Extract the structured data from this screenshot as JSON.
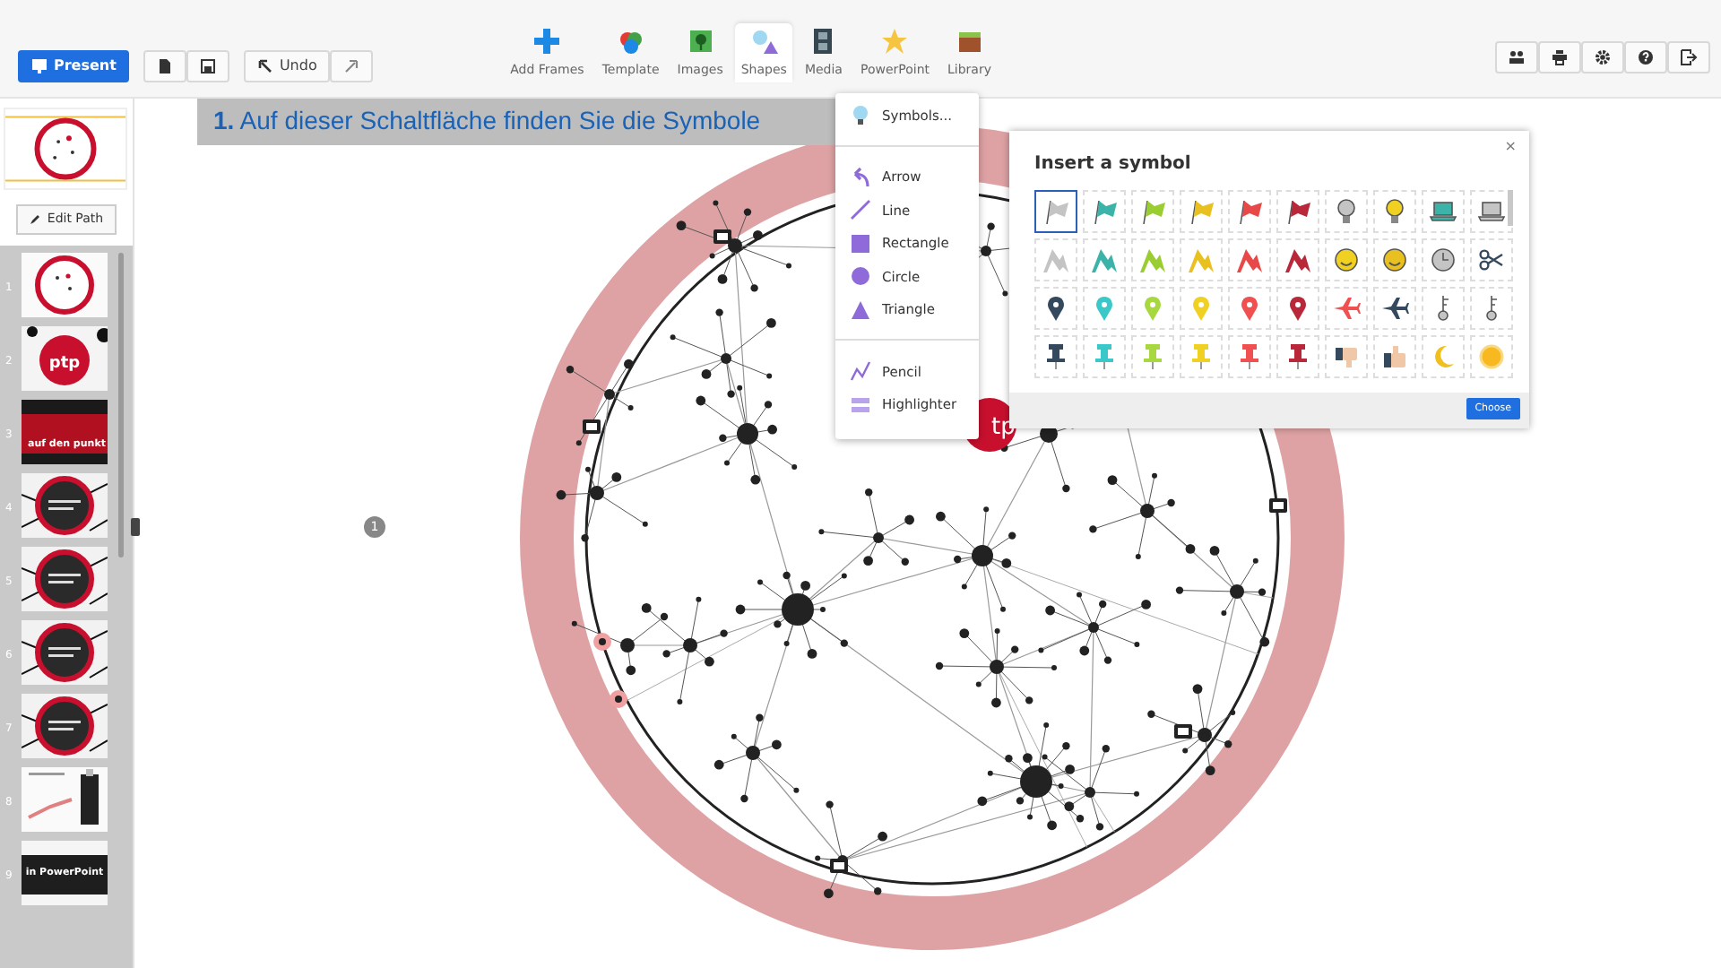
{
  "left_buttons": [
    {
      "kind": "present",
      "label": "Present"
    },
    {
      "kind": "new"
    },
    {
      "kind": "save"
    },
    {
      "kind": "undo",
      "label": "Undo"
    },
    {
      "kind": "redo"
    }
  ],
  "insert_tools": [
    {
      "kind": "frames",
      "label": "Add Frames",
      "selected": false
    },
    {
      "kind": "template",
      "label": "Template",
      "selected": false
    },
    {
      "kind": "images",
      "label": "Images",
      "selected": false
    },
    {
      "kind": "shapes",
      "label": "Shapes",
      "selected": true
    },
    {
      "kind": "media",
      "label": "Media",
      "selected": false
    },
    {
      "kind": "powerpoint",
      "label": "PowerPoint",
      "selected": false
    },
    {
      "kind": "library",
      "label": "Library",
      "selected": false
    }
  ],
  "right_buttons": [
    {
      "kind": "people"
    },
    {
      "kind": "print"
    },
    {
      "kind": "settings"
    },
    {
      "kind": "help"
    },
    {
      "kind": "exit"
    }
  ],
  "sidebar": {
    "edit_path": "Edit Path",
    "slides": [
      {
        "number": "1",
        "kind": "circle"
      },
      {
        "number": "2",
        "kind": "ptp",
        "text": "ptp"
      },
      {
        "number": "3",
        "kind": "banner",
        "text": "auf den punkt"
      },
      {
        "number": "4",
        "kind": "dark-circle"
      },
      {
        "number": "5",
        "kind": "dark-circle"
      },
      {
        "number": "6",
        "kind": "dark-circle"
      },
      {
        "number": "7",
        "kind": "dark-circle"
      },
      {
        "number": "8",
        "kind": "chart"
      },
      {
        "number": "9",
        "kind": "band",
        "text": "in PowerPoint"
      }
    ]
  },
  "callout": {
    "text": "**1.** Auf dieser Schaltfläche finden Sie die Symbole"
  },
  "canvas": {
    "step_badge": "1",
    "logo_text": "tp"
  },
  "shapes_menu": {
    "groups": [
      [
        {
          "kind": "bulb",
          "label": "Symbols..."
        }
      ],
      [
        {
          "kind": "arrow",
          "label": "Arrow"
        },
        {
          "kind": "line",
          "label": "Line"
        },
        {
          "kind": "rectangle",
          "label": "Rectangle"
        },
        {
          "kind": "circle",
          "label": "Circle"
        },
        {
          "kind": "triangle",
          "label": "Triangle"
        }
      ],
      [
        {
          "kind": "pencil",
          "label": "Pencil"
        },
        {
          "kind": "highlighter",
          "label": "Highlighter"
        }
      ]
    ]
  },
  "symbol_dialog": {
    "title": "Insert a symbol",
    "close": "×",
    "button": "Choose",
    "symbols": [
      {
        "kind": "flag",
        "color": "#c4c4c4",
        "selected": true
      },
      {
        "kind": "flag",
        "color": "#3bb3a8",
        "selected": false
      },
      {
        "kind": "flag",
        "color": "#9acd32",
        "selected": false
      },
      {
        "kind": "flag",
        "color": "#e8c020",
        "selected": false
      },
      {
        "kind": "flag",
        "color": "#e84848",
        "selected": false
      },
      {
        "kind": "flag",
        "color": "#b8283a",
        "selected": false
      },
      {
        "kind": "bulb",
        "color": "#c4c4c4",
        "selected": false
      },
      {
        "kind": "bulb",
        "color": "#f0d020",
        "selected": false
      },
      {
        "kind": "laptop",
        "color": "#3bb3a8",
        "selected": false
      },
      {
        "kind": "laptop",
        "color": "#c4c4c4",
        "selected": false
      },
      {
        "kind": "peak",
        "color": "#c4c4c4",
        "selected": false
      },
      {
        "kind": "peak",
        "color": "#3bb3a8",
        "selected": false
      },
      {
        "kind": "peak",
        "color": "#9acd32",
        "selected": false
      },
      {
        "kind": "peak",
        "color": "#e8c020",
        "selected": false
      },
      {
        "kind": "peak",
        "color": "#e84848",
        "selected": false
      },
      {
        "kind": "peak",
        "color": "#b8283a",
        "selected": false
      },
      {
        "kind": "smiley",
        "color": "#f0d020",
        "selected": false
      },
      {
        "kind": "smiley",
        "color": "#e8c020",
        "selected": false
      },
      {
        "kind": "clock",
        "color": "#c4c4c4",
        "selected": false
      },
      {
        "kind": "scissors",
        "color": "#34495e",
        "selected": false
      },
      {
        "kind": "pin",
        "color": "#34495e",
        "selected": false
      },
      {
        "kind": "pin",
        "color": "#3bc8c8",
        "selected": false
      },
      {
        "kind": "pin",
        "color": "#a8d840",
        "selected": false
      },
      {
        "kind": "pin",
        "color": "#f0d020",
        "selected": false
      },
      {
        "kind": "pin",
        "color": "#f05050",
        "selected": false
      },
      {
        "kind": "pin",
        "color": "#b8283a",
        "selected": false
      },
      {
        "kind": "plane",
        "color": "#f05050",
        "selected": false
      },
      {
        "kind": "plane",
        "color": "#34495e",
        "selected": false
      },
      {
        "kind": "key",
        "color": "#c4c4c4",
        "selected": false
      },
      {
        "kind": "key",
        "color": "#c4c4c4",
        "selected": false
      },
      {
        "kind": "pushpin",
        "color": "#34495e",
        "selected": false
      },
      {
        "kind": "pushpin",
        "color": "#3bc8c8",
        "selected": false
      },
      {
        "kind": "pushpin",
        "color": "#a8d840",
        "selected": false
      },
      {
        "kind": "pushpin",
        "color": "#f0d020",
        "selected": false
      },
      {
        "kind": "pushpin",
        "color": "#f05050",
        "selected": false
      },
      {
        "kind": "pushpin",
        "color": "#b8283a",
        "selected": false
      },
      {
        "kind": "thumbs-down",
        "color": "#f0c8a8",
        "selected": false
      },
      {
        "kind": "thumbs-up",
        "color": "#f0c8a8",
        "selected": false
      },
      {
        "kind": "moon",
        "color": "#f0c020",
        "selected": false
      },
      {
        "kind": "sun",
        "color": "#f8b820",
        "selected": false
      }
    ]
  }
}
